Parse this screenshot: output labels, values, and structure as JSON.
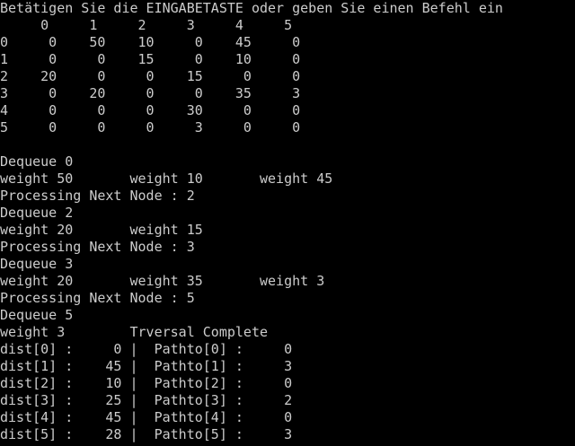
{
  "terminal": {
    "background": "#000000",
    "foreground": "#cccccc",
    "lines": [
      "Betätigen Sie die EINGABETASTE oder geben Sie einen Befehl ein",
      "     0     1     2     3     4     5",
      "0     0    50    10     0    45     0",
      "1     0     0    15     0    10     0",
      "2    20     0     0    15     0     0",
      "3     0    20     0     0    35     3",
      "4     0     0     0    30     0     0",
      "5     0     0     0     3     0     0",
      "",
      "Dequeue 0",
      "weight 50       weight 10       weight 45",
      "Processing Next Node : 2",
      "Dequeue 2",
      "weight 20       weight 15",
      "Processing Next Node : 3",
      "Dequeue 3",
      "weight 20       weight 35       weight 3",
      "Processing Next Node : 5",
      "Dequeue 5",
      "weight 3        Trversal Complete",
      "dist[0] :     0 |  Pathto[0] :     0",
      "dist[1] :    45 |  Pathto[1] :     3",
      "dist[2] :    10 |  Pathto[2] :     0",
      "dist[3] :    25 |  Pathto[3] :     2",
      "dist[4] :    45 |  Pathto[4] :     0",
      "dist[5] :    28 |  Pathto[5] :     3"
    ]
  }
}
